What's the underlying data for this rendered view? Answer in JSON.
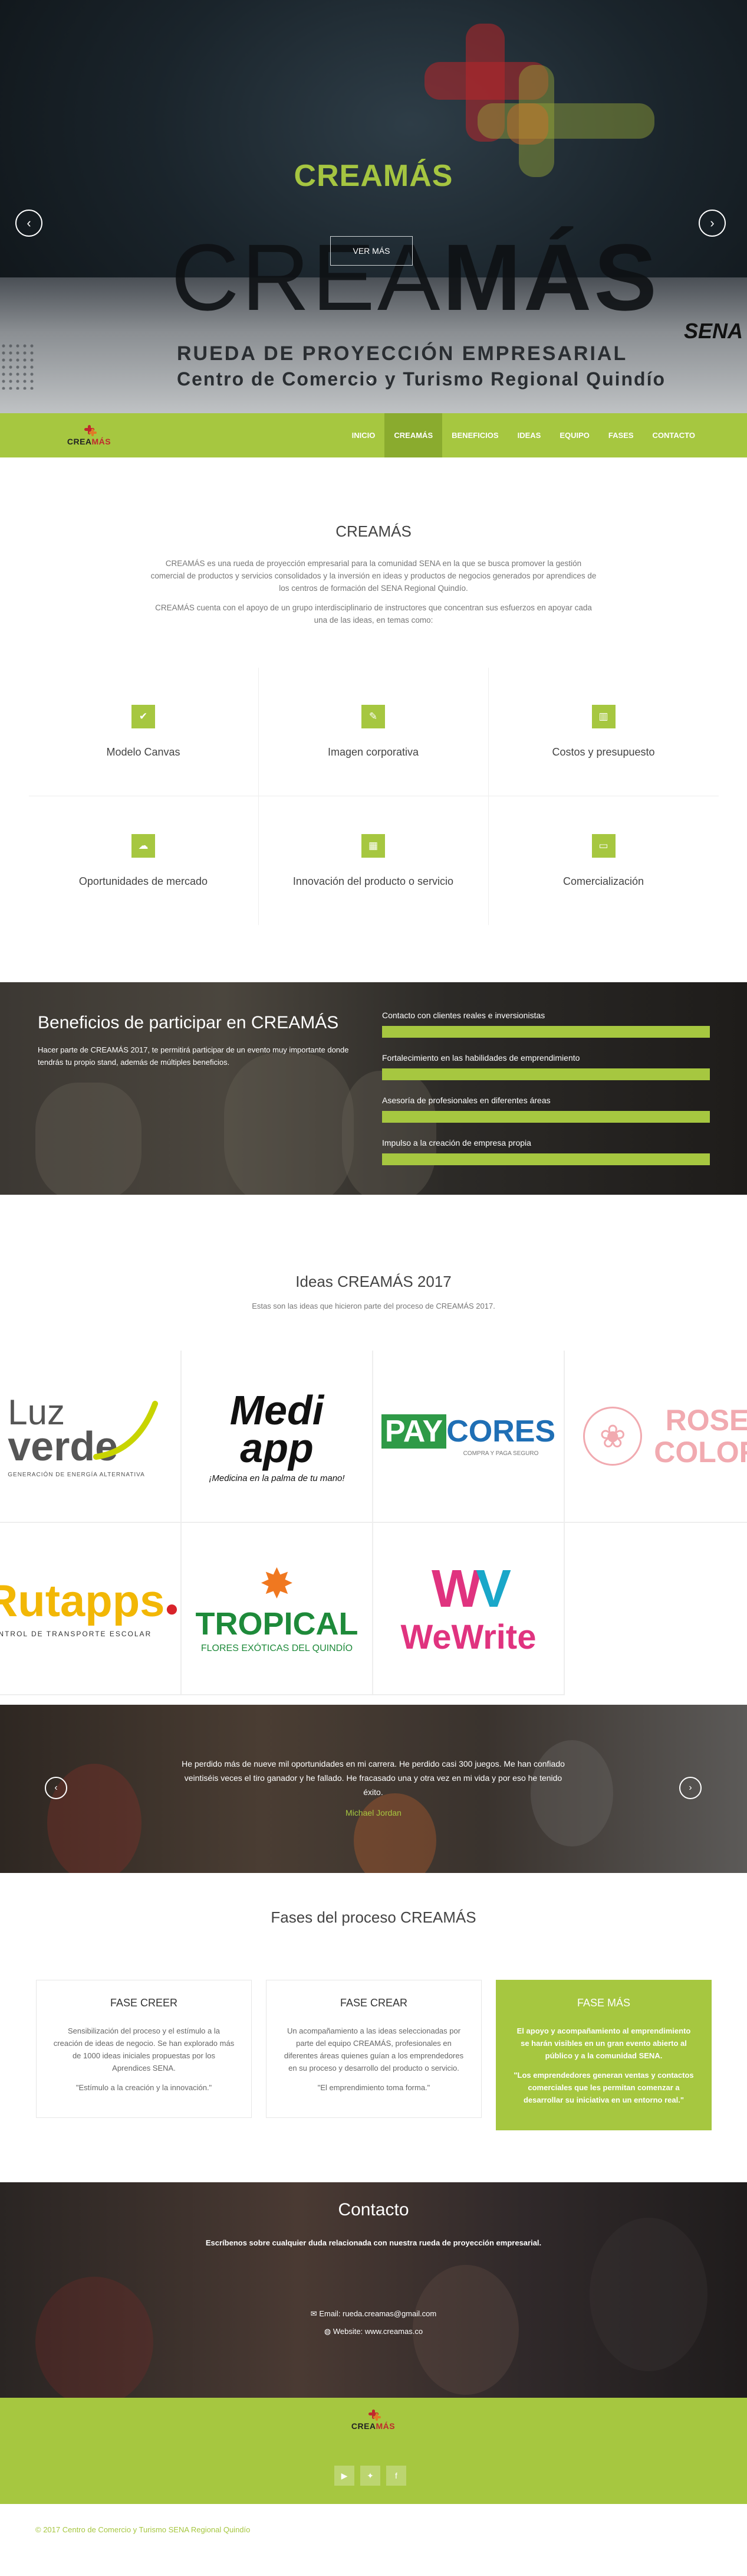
{
  "hero": {
    "title": "CREAMÁS",
    "button": "VER MÁS",
    "big_light": "CREA",
    "big_bold": "MÁS",
    "subtitle1": "RUEDA DE PROYECCIÓN EMPRESARIAL",
    "subtitle2": "Centro de Comercio y Turismo Regional Quindío",
    "sena": "SENA"
  },
  "nav": {
    "logo_a": "CREA",
    "logo_b": "MÁS",
    "items": [
      "INICIO",
      "CREAMÁS",
      "BENEFICIOS",
      "IDEAS",
      "EQUIPO",
      "FASES",
      "CONTACTO"
    ]
  },
  "intro": {
    "title": "CREAMÁS",
    "p1": "CREAMÁS es una rueda de proyección empresarial para la comunidad SENA en la que se busca promover la gestión comercial de productos y servicios consolidados y la inversión en ideas y productos de negocios generados por aprendices de los centros de formación del SENA Regional Quindío.",
    "p2": "CREAMÁS cuenta con el apoyo de un grupo interdisciplinario de instructores que concentran sus esfuerzos en apoyar cada una de las ideas, en temas como:",
    "features": [
      {
        "label": "Modelo Canvas",
        "icon": "check-icon"
      },
      {
        "label": "Imagen corporativa",
        "icon": "pencil-icon"
      },
      {
        "label": "Costos y presupuesto",
        "icon": "bar-chart-icon"
      },
      {
        "label": "Oportunidades de mercado",
        "icon": "cloud-icon"
      },
      {
        "label": "Innovación del producto o servicio",
        "icon": "grid-icon"
      },
      {
        "label": "Comercialización",
        "icon": "credit-card-icon"
      }
    ]
  },
  "benefits": {
    "title": "Beneficios de participar en CREAMÁS",
    "text": "Hacer parte de CREAMÁS 2017, te permitirá participar de un evento muy importante donde tendrás tu propio stand, además de múltiples beneficios.",
    "bars": [
      {
        "label": "Contacto con clientes reales e inversionistas",
        "value": 100
      },
      {
        "label": "Fortalecimiento en las habilidades de emprendimiento",
        "value": 100
      },
      {
        "label": "Asesoría de profesionales en diferentes áreas",
        "value": 100
      },
      {
        "label": "Impulso a la creación de empresa propia",
        "value": 100
      }
    ]
  },
  "ideas": {
    "title": "Ideas CREAMÁS 2017",
    "subtitle": "Estas son las ideas que hicieron parte del proceso de CREAMÁS 2017.",
    "logos": {
      "luz_a": "Luz",
      "luz_b": "verde",
      "luz_c": "GENERACIÓN DE ENERGÍA ALTERNATIVA",
      "medi_a": "Medi",
      "medi_b": "app",
      "medi_c": "¡Medicina en la palma de tu mano!",
      "pay_a": "PAY",
      "pay_b": "CORES",
      "pay_c": "COMPRA Y PAGA SEGURO",
      "rose_a": "ROSE",
      "rose_b": "COLOR",
      "rut_a": "Rutapps",
      "rut_b": "CONTROL DE TRANSPORTE ESCOLAR",
      "trop_a": "TROPICAL",
      "trop_b": "FLORES EXÓTICAS DEL QUINDÍO",
      "we_a": "WeWrite"
    }
  },
  "testimonial": {
    "quote": "He perdido más de nueve mil oportunidades en mi carrera. He perdido casi 300 juegos. Me han confiado veintiséis veces el tiro ganador y he fallado. He fracasado una y otra vez en mi vida y por eso he tenido éxito.",
    "author": "Michael Jordan"
  },
  "phases": {
    "title": "Fases del proceso CREAMÁS",
    "items": [
      {
        "title": "FASE CREER",
        "text": "Sensibilización del proceso y el estímulo a la creación de ideas de negocio. Se han explorado más de 1000 ideas iniciales propuestas por los Aprendices SENA.",
        "quote": "\"Estímulo a la creación y la innovación.\""
      },
      {
        "title": "FASE CREAR",
        "text": "Un acompañamiento a las ideas seleccionadas por parte del equipo CREAMÁS, profesionales en diferentes áreas quienes guían a los emprendedores en su proceso y desarrollo del producto o servicio.",
        "quote": "\"El emprendimiento toma forma.\""
      },
      {
        "title": "FASE MÁS",
        "text": "El apoyo y acompañamiento al emprendimiento se harán visibles en un gran evento abierto al público y a la comunidad SENA.",
        "quote": "\"Los emprendedores generan ventas y contactos comerciales que les permitan comenzar a desarrollar su iniciativa en un entorno real.\""
      }
    ]
  },
  "contact": {
    "title": "Contacto",
    "subtitle": "Escríbenos sobre cualquier duda relacionada con nuestra rueda de proyección empresarial.",
    "email": "Email: rueda.creamas@gmail.com",
    "website": "Website: www.creamas.co"
  },
  "footer": {
    "copyright": "© 2017 Centro de Comercio y Turismo SENA Regional Quindío",
    "social": [
      "youtube-icon",
      "twitter-icon",
      "facebook-icon"
    ]
  },
  "colors": {
    "accent": "#a6c740",
    "accent_dark": "#8aab2e",
    "brand_red": "#c0282d"
  }
}
